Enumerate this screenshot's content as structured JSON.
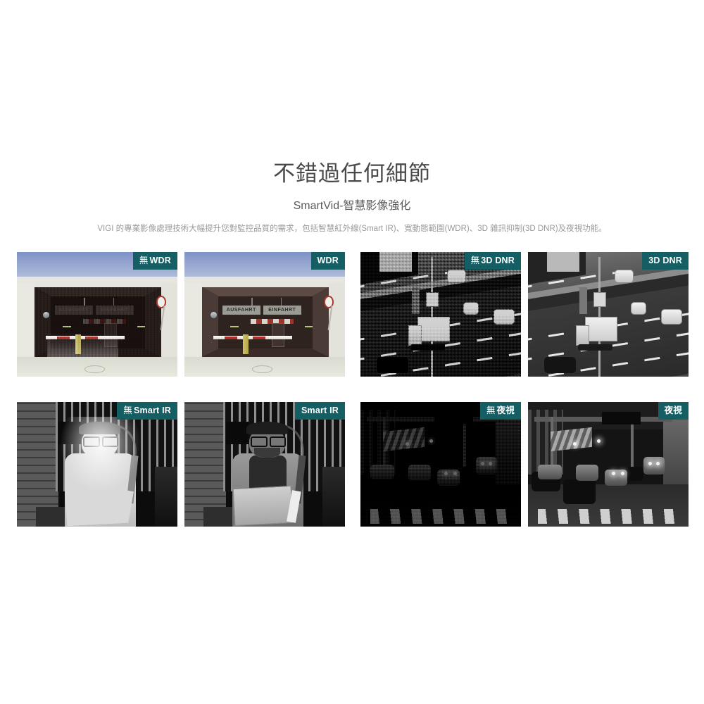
{
  "hero": {
    "title": "不錯過任何細節",
    "subtitle": "SmartVid-智慧影像強化",
    "description": "VIGI 的專業影像處理技術大幅提升您對監控品質的需求，包括智慧紅外線(Smart IR)、寬動態範圍(WDR)、3D 雜訊抑制(3D DNR)及夜視功能。"
  },
  "theme": {
    "badge_bg": "#155e63",
    "badge_text": "#ffffff",
    "title_color": "#4a4a4a",
    "subtitle_color": "#5a5a5a",
    "description_color": "#9a9a9a",
    "page_bg": "#ffffff"
  },
  "comparisons": [
    {
      "id": "wdr",
      "feature": "WDR",
      "scene": "parking-garage-entrance",
      "before": {
        "label_negation": "無",
        "label": "WDR",
        "state": "off"
      },
      "after": {
        "label_negation": "",
        "label": "WDR",
        "state": "on"
      },
      "scene_text": {
        "sign_left": "AUSFAHRT",
        "sign_right": "EINFAHRT"
      }
    },
    {
      "id": "3d-dnr",
      "feature": "3D DNR",
      "scene": "highway-overpass",
      "before": {
        "label_negation": "無",
        "label": "3D DNR",
        "state": "off"
      },
      "after": {
        "label_negation": "",
        "label": "3D DNR",
        "state": "on"
      }
    },
    {
      "id": "smart-ir",
      "feature": "Smart IR",
      "scene": "delivery-person-at-gate",
      "before": {
        "label_negation": "無",
        "label": "Smart IR",
        "state": "off"
      },
      "after": {
        "label_negation": "",
        "label": "Smart IR",
        "state": "on"
      }
    },
    {
      "id": "night-vision",
      "feature": "夜視",
      "scene": "night-city-street-traffic",
      "before": {
        "label_negation": "無",
        "label": "夜視",
        "state": "off"
      },
      "after": {
        "label_negation": "",
        "label": "夜視",
        "state": "on"
      }
    }
  ]
}
